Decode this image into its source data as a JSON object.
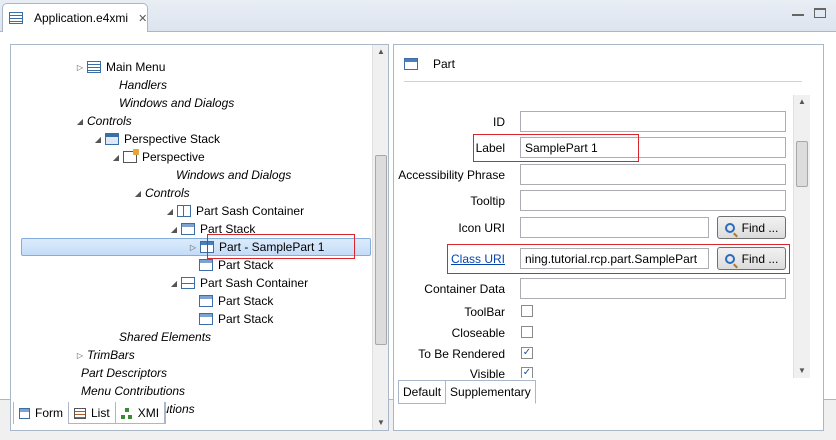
{
  "editor": {
    "tab_title": "Application.e4xmi",
    "close_glyph": "✕"
  },
  "tree": {
    "rows": [
      {
        "label": "Main Menu",
        "italic": false,
        "icon": "menu-icon",
        "twisty": "▷"
      },
      {
        "label": "Handlers",
        "italic": true
      },
      {
        "label": "Windows and Dialogs",
        "italic": true
      },
      {
        "label": "Controls",
        "italic": true,
        "twisty": "◢"
      },
      {
        "label": "Perspective Stack",
        "italic": false,
        "icon": "perspective-stack-icon",
        "twisty": "◢"
      },
      {
        "label": "Perspective",
        "italic": false,
        "icon": "perspective-icon",
        "twisty": "◢"
      },
      {
        "label": "Windows and Dialogs",
        "italic": true
      },
      {
        "label": "Controls",
        "italic": true,
        "twisty": "◢"
      },
      {
        "label": "Part Sash Container",
        "italic": false,
        "icon": "sash-container-icon",
        "twisty": "◢"
      },
      {
        "label": "Part Stack",
        "italic": false,
        "icon": "part-stack-icon",
        "twisty": "◢"
      },
      {
        "label": "Part - SamplePart 1",
        "italic": false,
        "icon": "part-icon",
        "twisty": "▷",
        "selected": true
      },
      {
        "label": "Part Stack",
        "italic": false,
        "icon": "part-stack-icon"
      },
      {
        "label": "Part Sash Container",
        "italic": false,
        "icon": "sash-container-icon",
        "twisty": "◢"
      },
      {
        "label": "Part Stack",
        "italic": false,
        "icon": "part-stack-icon"
      },
      {
        "label": "Part Stack",
        "italic": false,
        "icon": "part-stack-icon"
      },
      {
        "label": "Shared Elements",
        "italic": true
      },
      {
        "label": "TrimBars",
        "italic": true,
        "twisty": "▷"
      },
      {
        "label": "Part Descriptors",
        "italic": true
      },
      {
        "label": "Menu Contributions",
        "italic": true
      },
      {
        "label": "Toolbar Contributions",
        "italic": true
      }
    ],
    "scroll_up": "▲",
    "scroll_down": "▼"
  },
  "form": {
    "header": "Part",
    "fields": {
      "id_label": "ID",
      "id_value": "",
      "label_label": "Label",
      "label_value": "SamplePart 1",
      "accessibility_label": "Accessibility Phrase",
      "accessibility_value": "",
      "tooltip_label": "Tooltip",
      "tooltip_value": "",
      "icon_uri_label": "Icon URI",
      "icon_uri_value": "",
      "class_uri_label": "Class URI",
      "class_uri_value": "ning.tutorial.rcp.part.SamplePart",
      "container_data_label": "Container Data",
      "container_data_value": "",
      "toolbar_label": "ToolBar",
      "closeable_label": "Closeable",
      "to_be_rendered_label": "To Be Rendered",
      "visible_label": "Visible"
    },
    "checkboxes": {
      "toolbar": false,
      "closeable": false,
      "to_be_rendered": true,
      "visible": true
    },
    "check_glyph": "✓",
    "find_button_label": "Find ...",
    "tabs": [
      "Default",
      "Supplementary"
    ]
  },
  "bottom_tabs": [
    "Form",
    "List",
    "XMI"
  ],
  "colors": {
    "highlight_red": "#d9252c",
    "selection_blue": "#c4dcf8",
    "link_blue": "#0645ad"
  }
}
